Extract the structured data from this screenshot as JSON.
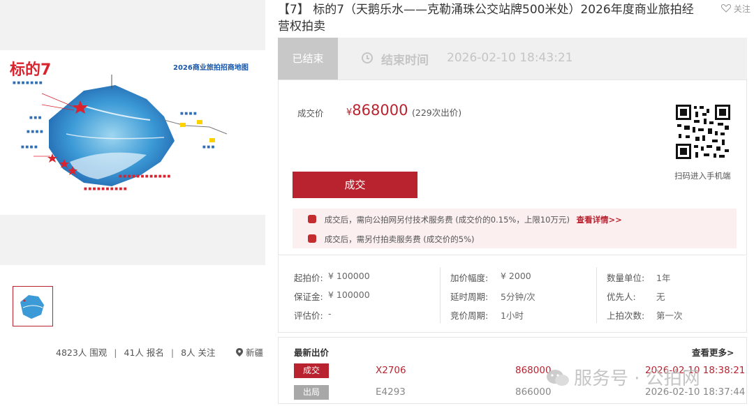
{
  "lot": {
    "title": "【7】 标的7（天鹅乐水——克勒涌珠公交站牌500米处）2026年度商业旅拍经营权拍卖",
    "follow_label": "关注"
  },
  "image": {
    "map_label_left": "标的7",
    "map_label_right": "2026商业旅拍招商地图"
  },
  "stats": {
    "views": "4823人 围观",
    "signups": "41人 报名",
    "followers": "8人 关注",
    "separator": "|",
    "location": "新疆"
  },
  "status": {
    "state_label": "已结束",
    "end_label": "结束时间",
    "end_time": "2026-02-10 18:43:21"
  },
  "price": {
    "label": "成交价",
    "currency": "¥",
    "value": "868000",
    "bid_count": "(229次出价)",
    "deal_button": "成交",
    "qr_label": "扫码进入手机端"
  },
  "notices": [
    {
      "text": "成交后，需向公拍网另付技术服务费 (成交价的0.15%，上限10万元)",
      "link": "查看详情>>"
    },
    {
      "text": "成交后，需另付拍卖服务费 (成交价的5%)",
      "link": ""
    }
  ],
  "params": {
    "col1": [
      {
        "label": "起拍价:",
        "value": "¥ 100000"
      },
      {
        "label": "保证金:",
        "value": "¥ 100000"
      },
      {
        "label": "评估价:",
        "value": "-"
      }
    ],
    "col2": [
      {
        "label": "加价幅度:",
        "value": "¥ 2000"
      },
      {
        "label": "延时周期:",
        "value": "5分钟/次"
      },
      {
        "label": "竞价周期:",
        "value": "1小时"
      }
    ],
    "col3": [
      {
        "label": "数量单位:",
        "value": "1年"
      },
      {
        "label": "优先人:",
        "value": "无"
      },
      {
        "label": "上拍次数:",
        "value": "第一次"
      }
    ]
  },
  "bids": {
    "title": "最新出价",
    "more_label": "查看更多>",
    "rows": [
      {
        "status": "成交",
        "bidder": "X2706",
        "amount": "868000",
        "time": "2026-02-10 18:38:21",
        "status_color": "#b8232f",
        "text_color": "#b8232f"
      },
      {
        "status": "出局",
        "bidder": "E4293",
        "amount": "866000",
        "time": "2026-02-10 18:37:44",
        "status_color": "#a8a8a8",
        "text_color": "#888888"
      }
    ]
  },
  "watermark": "服务号 · 公拍网",
  "colors": {
    "accent": "#b8232f",
    "notice_bg": "#fbeff0",
    "status_bar_bg": "#f0f0f0"
  }
}
